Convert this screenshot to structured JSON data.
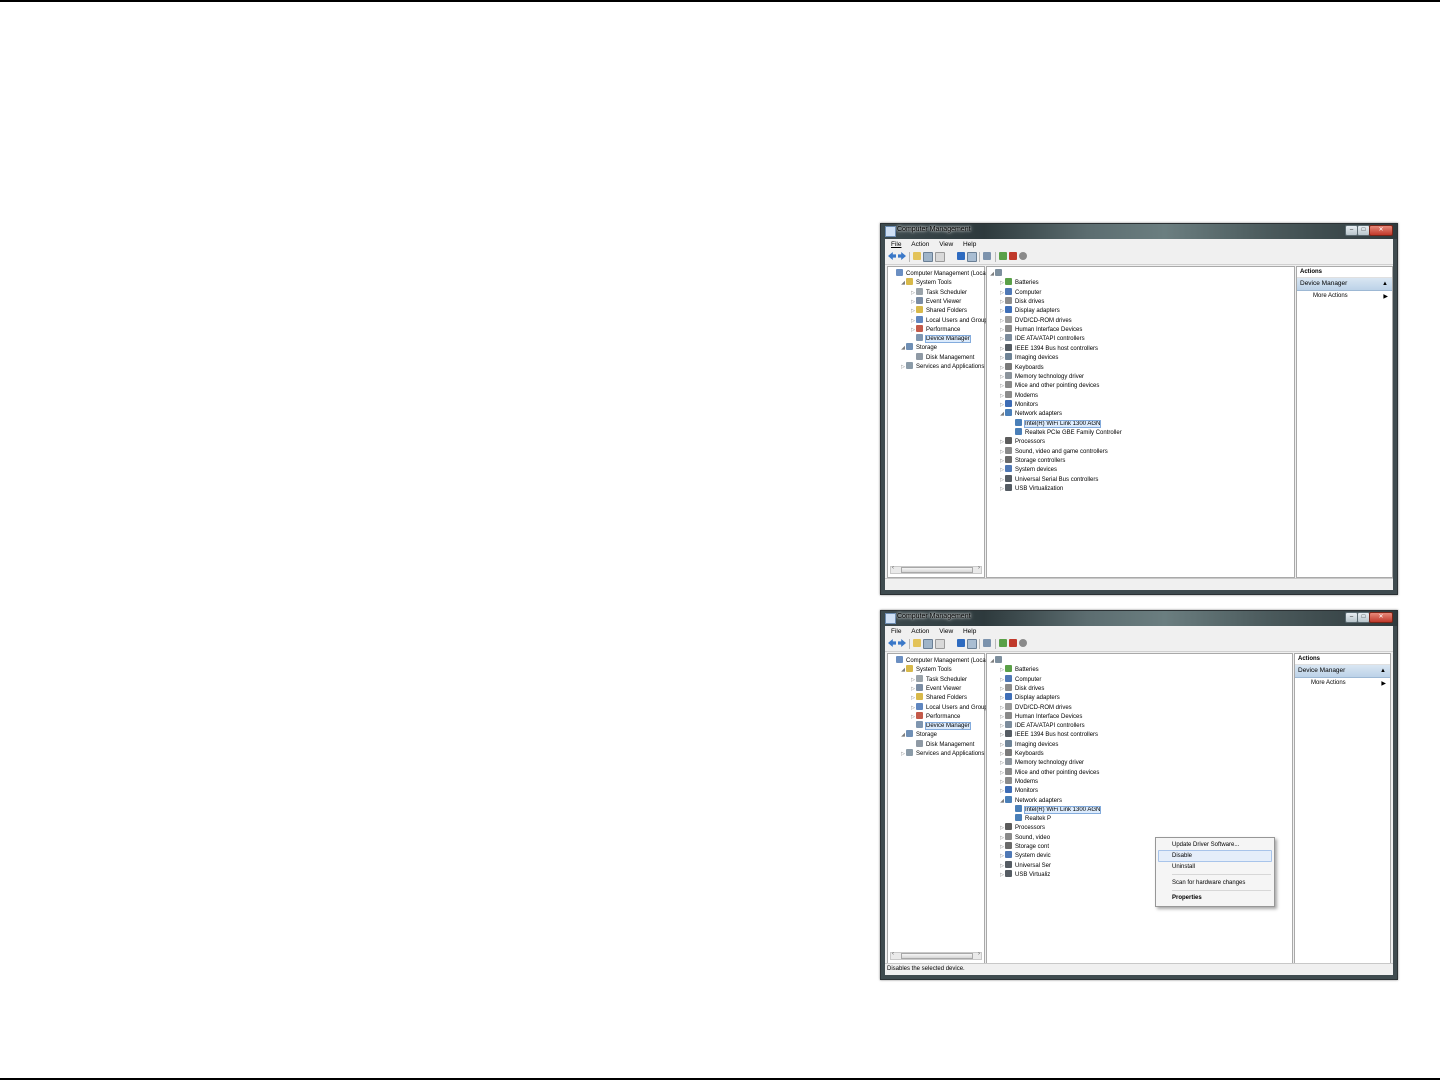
{
  "windows": [
    {
      "title": "Computer Management",
      "menu": [
        "File",
        "Action",
        "View",
        "Help"
      ],
      "left_tree": [
        {
          "label": "Computer Management (Local",
          "indent": 0,
          "tri": "",
          "icon": "#6b8fc2"
        },
        {
          "label": "System Tools",
          "indent": 1,
          "tri": "◢",
          "icon": "#d8b94a"
        },
        {
          "label": "Task Scheduler",
          "indent": 2,
          "tri": "▷",
          "icon": "#9aa3aa"
        },
        {
          "label": "Event Viewer",
          "indent": 2,
          "tri": "▷",
          "icon": "#7b8da4"
        },
        {
          "label": "Shared Folders",
          "indent": 2,
          "tri": "▷",
          "icon": "#d8b94a"
        },
        {
          "label": "Local Users and Groups",
          "indent": 2,
          "tri": "▷",
          "icon": "#5f86c0"
        },
        {
          "label": "Performance",
          "indent": 2,
          "tri": "▷",
          "icon": "#c45a4a"
        },
        {
          "label": "Device Manager",
          "indent": 2,
          "tri": "",
          "icon": "#7f96b0",
          "selected": true
        },
        {
          "label": "Storage",
          "indent": 1,
          "tri": "◢",
          "icon": "#6f8fb5"
        },
        {
          "label": "Disk Management",
          "indent": 2,
          "tri": "",
          "icon": "#8f9aa5"
        },
        {
          "label": "Services and Applications",
          "indent": 1,
          "tri": "▷",
          "icon": "#8b9ba8"
        }
      ],
      "device_tree": [
        {
          "label": "",
          "indent": 0,
          "tri": "◢",
          "icon": "#7d8f9e"
        },
        {
          "label": "Batteries",
          "indent": 1,
          "tri": "▷",
          "icon": "#5aa048"
        },
        {
          "label": "Computer",
          "indent": 1,
          "tri": "▷",
          "icon": "#4f78b5"
        },
        {
          "label": "Disk drives",
          "indent": 1,
          "tri": "▷",
          "icon": "#8c8c8c"
        },
        {
          "label": "Display adapters",
          "indent": 1,
          "tri": "▷",
          "icon": "#3f6fb8"
        },
        {
          "label": "DVD/CD-ROM drives",
          "indent": 1,
          "tri": "▷",
          "icon": "#9a9a9a"
        },
        {
          "label": "Human Interface Devices",
          "indent": 1,
          "tri": "▷",
          "icon": "#8a8a8a"
        },
        {
          "label": "IDE ATA/ATAPI controllers",
          "indent": 1,
          "tri": "▷",
          "icon": "#7c8c9c"
        },
        {
          "label": "IEEE 1394 Bus host controllers",
          "indent": 1,
          "tri": "▷",
          "icon": "#555c63"
        },
        {
          "label": "Imaging devices",
          "indent": 1,
          "tri": "▷",
          "icon": "#6e8396"
        },
        {
          "label": "Keyboards",
          "indent": 1,
          "tri": "▷",
          "icon": "#7a7a7a"
        },
        {
          "label": "Memory technology driver",
          "indent": 1,
          "tri": "▷",
          "icon": "#8c949c"
        },
        {
          "label": "Mice and other pointing devices",
          "indent": 1,
          "tri": "▷",
          "icon": "#8a8a8a"
        },
        {
          "label": "Modems",
          "indent": 1,
          "tri": "▷",
          "icon": "#8c8c8c"
        },
        {
          "label": "Monitors",
          "indent": 1,
          "tri": "▷",
          "icon": "#3d6cb5"
        },
        {
          "label": "Network adapters",
          "indent": 1,
          "tri": "◢",
          "icon": "#4a7fb8"
        },
        {
          "label": "Intel(R) WiFi Link 1300 AGN",
          "indent": 2,
          "tri": "",
          "icon": "#4a7fb8",
          "selected": true
        },
        {
          "label": "Realtek PCIe GBE Family Controller",
          "indent": 2,
          "tri": "",
          "icon": "#4a7fb8"
        },
        {
          "label": "Processors",
          "indent": 1,
          "tri": "▷",
          "icon": "#5c5c5c"
        },
        {
          "label": "Sound, video and game controllers",
          "indent": 1,
          "tri": "▷",
          "icon": "#8a8a8a"
        },
        {
          "label": "Storage controllers",
          "indent": 1,
          "tri": "▷",
          "icon": "#6a6a6a"
        },
        {
          "label": "System devices",
          "indent": 1,
          "tri": "▷",
          "icon": "#4f78b5"
        },
        {
          "label": "Universal Serial Bus controllers",
          "indent": 1,
          "tri": "▷",
          "icon": "#555c63"
        },
        {
          "label": "USB Virtualization",
          "indent": 1,
          "tri": "▷",
          "icon": "#555c63"
        }
      ],
      "actions": {
        "header": "Actions",
        "section": "Device Manager",
        "more": "More Actions"
      },
      "status": ""
    },
    {
      "title": "Computer Management",
      "menu": [
        "File",
        "Action",
        "View",
        "Help"
      ],
      "left_tree": [
        {
          "label": "Computer Management (Local",
          "indent": 0,
          "tri": "",
          "icon": "#6b8fc2"
        },
        {
          "label": "System Tools",
          "indent": 1,
          "tri": "◢",
          "icon": "#d8b94a"
        },
        {
          "label": "Task Scheduler",
          "indent": 2,
          "tri": "▷",
          "icon": "#9aa3aa"
        },
        {
          "label": "Event Viewer",
          "indent": 2,
          "tri": "▷",
          "icon": "#7b8da4"
        },
        {
          "label": "Shared Folders",
          "indent": 2,
          "tri": "▷",
          "icon": "#d8b94a"
        },
        {
          "label": "Local Users and Groups",
          "indent": 2,
          "tri": "▷",
          "icon": "#5f86c0"
        },
        {
          "label": "Performance",
          "indent": 2,
          "tri": "▷",
          "icon": "#c45a4a"
        },
        {
          "label": "Device Manager",
          "indent": 2,
          "tri": "",
          "icon": "#7f96b0",
          "selected": true
        },
        {
          "label": "Storage",
          "indent": 1,
          "tri": "◢",
          "icon": "#6f8fb5"
        },
        {
          "label": "Disk Management",
          "indent": 2,
          "tri": "",
          "icon": "#8f9aa5"
        },
        {
          "label": "Services and Applications",
          "indent": 1,
          "tri": "▷",
          "icon": "#8b9ba8"
        }
      ],
      "device_tree": [
        {
          "label": "",
          "indent": 0,
          "tri": "◢",
          "icon": "#7d8f9e"
        },
        {
          "label": "Batteries",
          "indent": 1,
          "tri": "▷",
          "icon": "#5aa048"
        },
        {
          "label": "Computer",
          "indent": 1,
          "tri": "▷",
          "icon": "#4f78b5"
        },
        {
          "label": "Disk drives",
          "indent": 1,
          "tri": "▷",
          "icon": "#8c8c8c"
        },
        {
          "label": "Display adapters",
          "indent": 1,
          "tri": "▷",
          "icon": "#3f6fb8"
        },
        {
          "label": "DVD/CD-ROM drives",
          "indent": 1,
          "tri": "▷",
          "icon": "#9a9a9a"
        },
        {
          "label": "Human Interface Devices",
          "indent": 1,
          "tri": "▷",
          "icon": "#8a8a8a"
        },
        {
          "label": "IDE ATA/ATAPI controllers",
          "indent": 1,
          "tri": "▷",
          "icon": "#7c8c9c"
        },
        {
          "label": "IEEE 1394 Bus host controllers",
          "indent": 1,
          "tri": "▷",
          "icon": "#555c63"
        },
        {
          "label": "Imaging devices",
          "indent": 1,
          "tri": "▷",
          "icon": "#6e8396"
        },
        {
          "label": "Keyboards",
          "indent": 1,
          "tri": "▷",
          "icon": "#7a7a7a"
        },
        {
          "label": "Memory technology driver",
          "indent": 1,
          "tri": "▷",
          "icon": "#8c949c"
        },
        {
          "label": "Mice and other pointing devices",
          "indent": 1,
          "tri": "▷",
          "icon": "#8a8a8a"
        },
        {
          "label": "Modems",
          "indent": 1,
          "tri": "▷",
          "icon": "#8c8c8c"
        },
        {
          "label": "Monitors",
          "indent": 1,
          "tri": "▷",
          "icon": "#3d6cb5"
        },
        {
          "label": "Network adapters",
          "indent": 1,
          "tri": "◢",
          "icon": "#4a7fb8"
        },
        {
          "label": "Intel(R) WiFi Link 1300 AGN",
          "indent": 2,
          "tri": "",
          "icon": "#4a7fb8",
          "selected": true
        },
        {
          "label": "Realtek P",
          "indent": 2,
          "tri": "",
          "icon": "#4a7fb8"
        },
        {
          "label": "Processors",
          "indent": 1,
          "tri": "▷",
          "icon": "#5c5c5c"
        },
        {
          "label": "Sound, video",
          "indent": 1,
          "tri": "▷",
          "icon": "#8a8a8a"
        },
        {
          "label": "Storage cont",
          "indent": 1,
          "tri": "▷",
          "icon": "#6a6a6a"
        },
        {
          "label": "System devic",
          "indent": 1,
          "tri": "▷",
          "icon": "#4f78b5"
        },
        {
          "label": "Universal Ser",
          "indent": 1,
          "tri": "▷",
          "icon": "#555c63"
        },
        {
          "label": "USB Virtualiz",
          "indent": 1,
          "tri": "▷",
          "icon": "#555c63"
        }
      ],
      "actions": {
        "header": "Actions",
        "section": "Device Manager",
        "more": "More Actions"
      },
      "status": "Disables the selected device.",
      "context_menu": {
        "items": [
          "Update Driver Software...",
          "Disable",
          "Uninstall",
          "Scan for hardware changes",
          "Properties"
        ],
        "highlighted": "Disable"
      }
    }
  ],
  "toolbar_icons": [
    "back-arrow-icon",
    "forward-arrow-icon",
    "up-folder-icon",
    "show-hide-tree-icon",
    "export-list-icon",
    "help-icon",
    "action-pane-icon",
    "scan-hardware-icon",
    "update-driver-icon",
    "uninstall-icon",
    "disable-icon"
  ]
}
